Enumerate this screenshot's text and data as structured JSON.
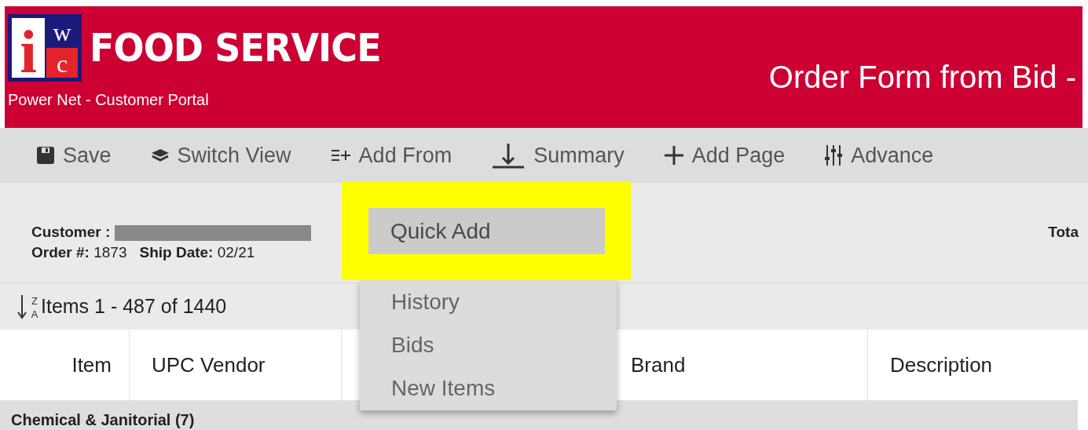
{
  "header": {
    "logo_letters": {
      "main": "i",
      "top": "w",
      "bottom": "c"
    },
    "brand": "FOOD SERVICE",
    "subtitle": "Power Net - Customer Portal",
    "title": "Order Form from Bid -"
  },
  "toolbar": [
    {
      "kind": "save",
      "label": "Save"
    },
    {
      "kind": "layers",
      "label": "Switch View"
    },
    {
      "kind": "listplus",
      "label": "Add From"
    },
    {
      "kind": "download",
      "label": "Summary"
    },
    {
      "kind": "plus",
      "label": "Add Page"
    },
    {
      "kind": "sliders",
      "label": "Advance"
    }
  ],
  "order_info": {
    "customer_label": "Customer :",
    "order_label": "Order #:",
    "order_number": "1873",
    "ship_label": "Ship Date:",
    "ship_date": "02/21",
    "total_label": "Tota"
  },
  "items_bar": {
    "sort_letters": [
      "Z",
      "A"
    ],
    "range": "Items 1 - 487 of 1440"
  },
  "table": {
    "columns": [
      "Item",
      "UPC Vendor",
      "",
      "Brand",
      "Description"
    ],
    "group_row": "Chemical & Janitorial (7)"
  },
  "dropdown": {
    "items": [
      {
        "label": "Quick Add",
        "selected": true
      },
      {
        "label": "History",
        "selected": false
      },
      {
        "label": "Bids",
        "selected": false
      },
      {
        "label": "New Items",
        "selected": false
      }
    ]
  }
}
